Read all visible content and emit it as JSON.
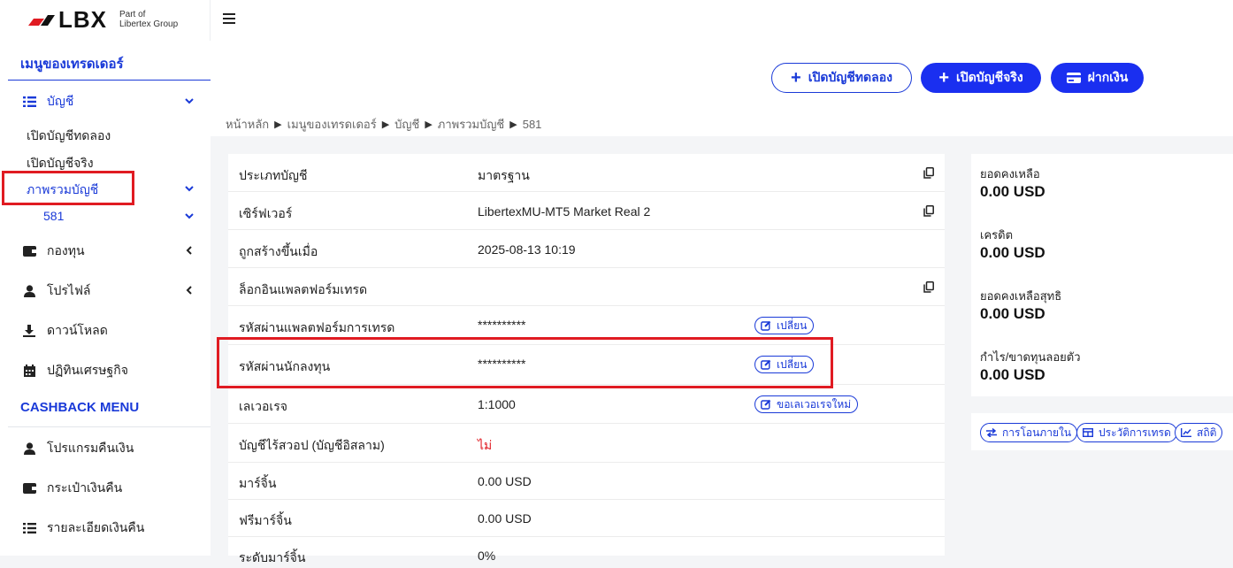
{
  "header": {
    "logo": {
      "brand": "LBX",
      "group_line1": "Part of",
      "group_line2": "Libertex Group"
    },
    "menu_icon": "hamburger-icon"
  },
  "sidebar": {
    "trader_menu_title": "เมนูของเทรดเดอร์",
    "accounts": {
      "label": "บัญชี",
      "icon": "list-icon"
    },
    "account_subitems": [
      "เปิดบัญชีทดลอง",
      "เปิดบัญชีจริง"
    ],
    "overview": {
      "label": "ภาพรวมบัญชี",
      "account_number": "581"
    },
    "items": [
      {
        "label": "กองทุน",
        "icon": "wallet-icon"
      },
      {
        "label": "โปรไฟล์",
        "icon": "user-icon"
      },
      {
        "label": "ดาวน์โหลด",
        "icon": "download-icon"
      },
      {
        "label": "ปฏิทินเศรษฐกิจ",
        "icon": "calendar-icon"
      }
    ],
    "cashback_title": "CASHBACK MENU",
    "cashback_items": [
      {
        "label": "โปรแกรมคืนเงิน",
        "icon": "user-icon"
      },
      {
        "label": "กระเป๋าเงินคืน",
        "icon": "wallet-icon"
      },
      {
        "label": "รายละเอียดเงินคืน",
        "icon": "list-icon"
      }
    ]
  },
  "toolbar": {
    "open_demo": "เปิดบัญชีทดลอง",
    "open_real": "เปิดบัญชีจริง",
    "deposit": "ฝากเงิน"
  },
  "breadcrumb": [
    "หน้าหลัก",
    "เมนูของเทรดเดอร์",
    "บัญชี",
    "ภาพรวมบัญชี",
    "581"
  ],
  "details": [
    {
      "label": "ประเภทบัญชี",
      "value": "มาตรฐาน"
    },
    {
      "label": "เซิร์ฟเวอร์",
      "value": "LibertexMU-MT5 Market Real 2"
    },
    {
      "label": "ถูกสร้างขึ้นเมื่อ",
      "value": "2025-08-13 10:19"
    },
    {
      "label": "ล็อกอินแพลตฟอร์มเทรด",
      "value": ""
    },
    {
      "label": "รหัสผ่านแพลตฟอร์มการเทรด",
      "value": "**********",
      "action": "เปลี่ยน"
    },
    {
      "label": "รหัสผ่านนักลงทุน",
      "value": "**********",
      "action": "เปลี่ยน"
    },
    {
      "label": "เลเวอเรจ",
      "value": "1:1000",
      "action": "ขอเลเวอเรจใหม่"
    },
    {
      "label": "บัญชีไร้สวอป (บัญชีอิสลาม)",
      "value": "ไม่"
    },
    {
      "label": "มาร์จิ้น",
      "value": "0.00 USD"
    },
    {
      "label": "ฟรีมาร์จิ้น",
      "value": "0.00 USD"
    },
    {
      "label": "ระดับมาร์จิ้น",
      "value": "0%"
    }
  ],
  "summary": [
    {
      "label": "ยอดคงเหลือ",
      "value": "0.00 USD"
    },
    {
      "label": "เครดิต",
      "value": "0.00 USD"
    },
    {
      "label": "ยอดคงเหลือสุทธิ",
      "value": "0.00 USD"
    },
    {
      "label": "กำไร/ขาดทุนลอยตัว",
      "value": "0.00 USD"
    }
  ],
  "actions": [
    "การโอนภายใน",
    "ประวัติการเทรด",
    "สถิติ"
  ],
  "colors": {
    "accent": "#1a3ad8",
    "highlight": "#e01b22",
    "no_value": "#e01b22"
  }
}
